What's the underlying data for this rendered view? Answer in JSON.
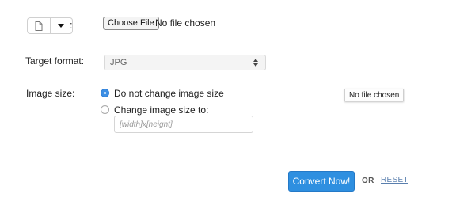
{
  "source": {
    "file_icon": "file-icon",
    "dropdown_icon": "caret-down-icon",
    "separator": ":",
    "choose_file_label": "Choose File",
    "file_status": "No file chosen"
  },
  "target_format": {
    "label": "Target format:",
    "selected": "JPG",
    "arrow_icon": "select-arrows-icon"
  },
  "image_size": {
    "label": "Image size:",
    "options": [
      {
        "label": "Do not change image size",
        "selected": true
      },
      {
        "label": "Change image size to:",
        "selected": false
      }
    ],
    "dimensions_placeholder": "[width]x[height]"
  },
  "tooltip": {
    "text": "No file chosen"
  },
  "actions": {
    "convert_label": "Convert Now!",
    "or_label": "OR",
    "reset_label": "RESET"
  },
  "colors": {
    "primary_button": "#2e8fe0",
    "radio_selected": "#3d8fe4",
    "reset_link": "#5a7fae"
  }
}
